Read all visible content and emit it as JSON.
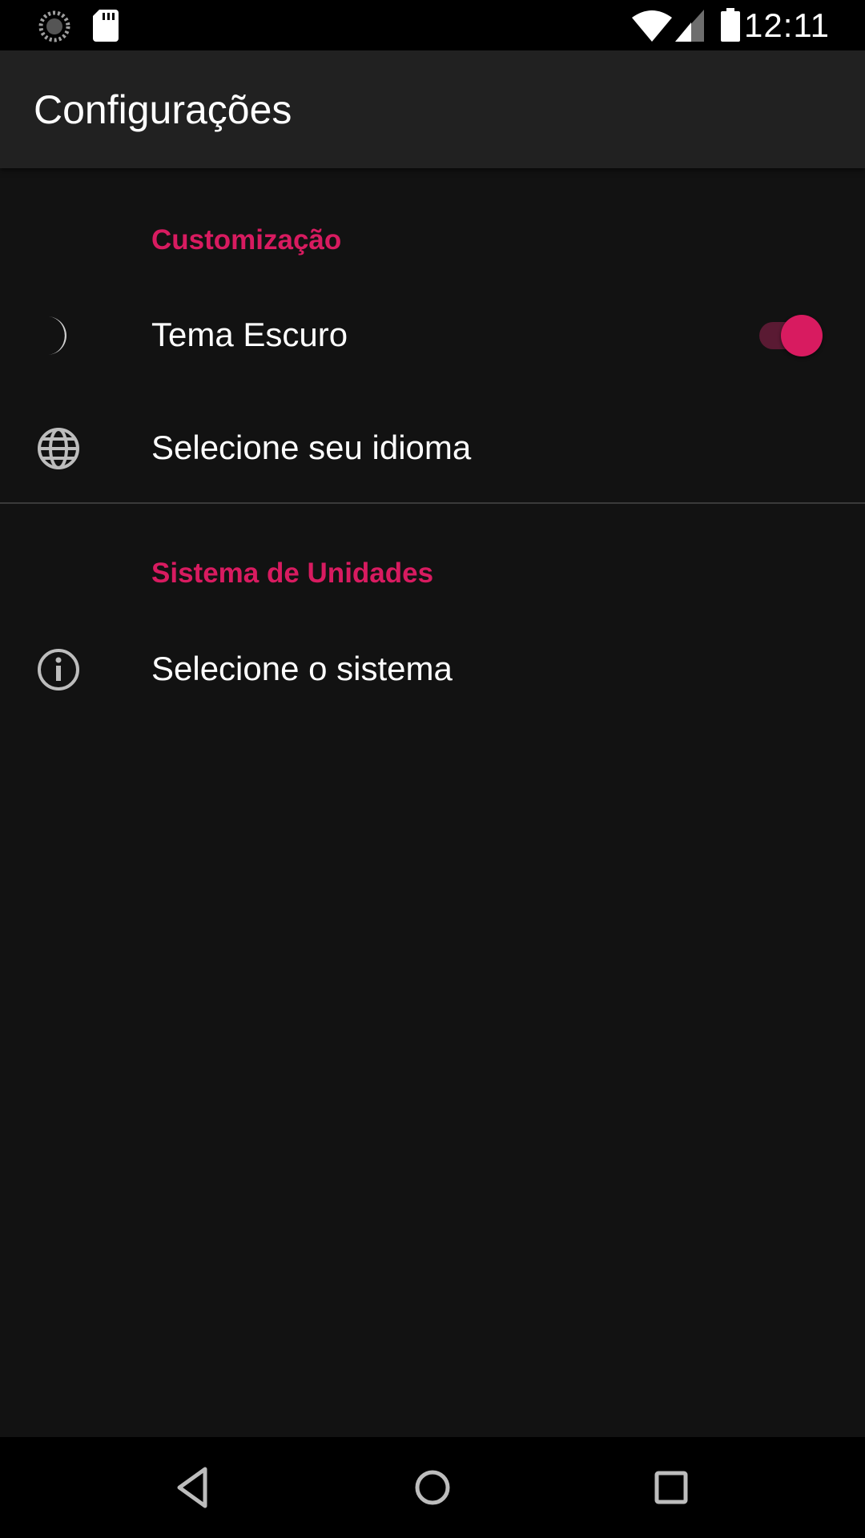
{
  "status_bar": {
    "time": "12:11",
    "icons": [
      "loading-icon",
      "sd-card-icon",
      "wifi-icon",
      "cell-signal-icon",
      "battery-icon"
    ]
  },
  "app_bar": {
    "title": "Configurações"
  },
  "sections": [
    {
      "title": "Customização",
      "items": [
        {
          "label": "Tema Escuro",
          "icon": "moon-icon",
          "switch_on": true
        },
        {
          "label": "Selecione seu idioma",
          "icon": "globe-icon"
        }
      ]
    },
    {
      "title": "Sistema de Unidades",
      "items": [
        {
          "label": "Selecione o sistema",
          "icon": "info-icon"
        }
      ]
    }
  ],
  "colors": {
    "accent": "#d81b60",
    "background": "#121212",
    "app_bar": "#212121",
    "text": "#ffffff",
    "icon": "#bdbdbd"
  },
  "nav_bar": {
    "buttons": [
      "back-icon",
      "home-icon",
      "recents-icon"
    ]
  }
}
